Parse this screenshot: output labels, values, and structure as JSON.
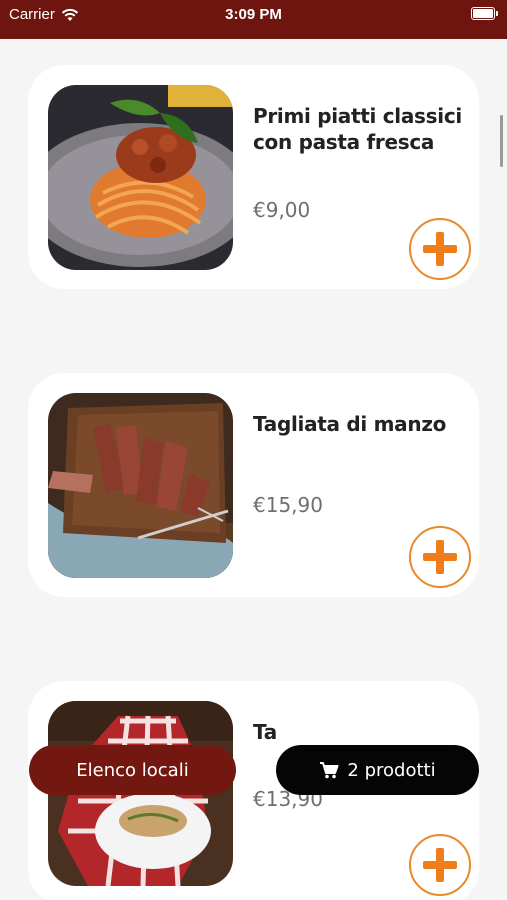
{
  "status_bar": {
    "carrier": "Carrier",
    "time": "3:09 PM"
  },
  "products": [
    {
      "name": "Primi piatti classici con pasta fresca",
      "price": "€9,00",
      "image": "pasta-with-ragu-photo"
    },
    {
      "name": "Tagliata di manzo",
      "price": "€15,90",
      "image": "sliced-beef-steak-photo"
    },
    {
      "name": "Ta",
      "price": "€13,90",
      "image": "grilled-dish-on-checkered-cloth-photo"
    }
  ],
  "bottom_bar": {
    "locations_button": "Elenco locali",
    "cart_button": "2 prodotti"
  },
  "colors": {
    "header": "#6e1510",
    "accent_orange": "#ee7d1a",
    "locations_button_bg": "#721810",
    "cart_button_bg": "#050505"
  }
}
